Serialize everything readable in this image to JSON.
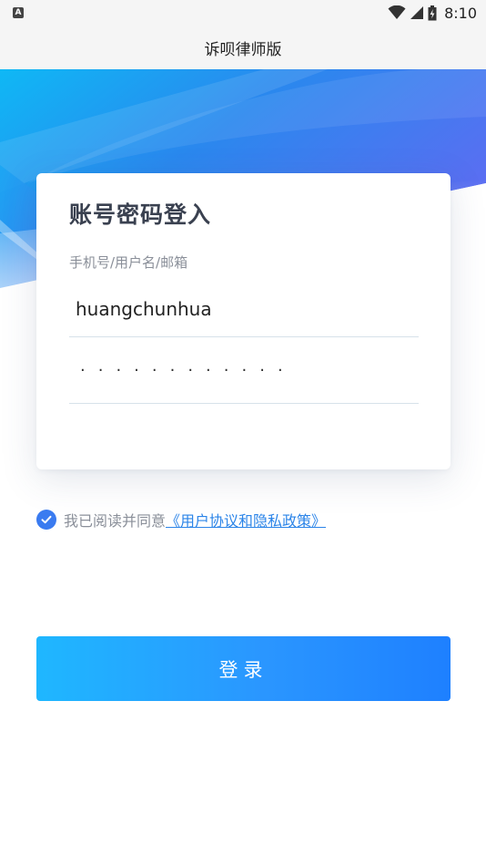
{
  "status_bar": {
    "indicator": "A",
    "time": "8:10",
    "icons": [
      "wifi-icon",
      "signal-icon",
      "battery-icon"
    ]
  },
  "app": {
    "title": "诉呗律师版"
  },
  "login_card": {
    "title": "账号密码登入",
    "username_label": "手机号/用户名/邮箱",
    "username_value": "huangchunhua",
    "password_value": "············"
  },
  "agreement": {
    "checked": true,
    "text": "我已阅读并同意",
    "link": "《用户协议和隐私政策》"
  },
  "login_button": {
    "label": "登录"
  },
  "colors": {
    "accent": "#3a7bf0",
    "link": "#2b84e8",
    "button_start": "#1fb7ff",
    "button_end": "#1e80ff",
    "hero_left": "#0a90f0",
    "hero_right": "#5b6ff0"
  }
}
